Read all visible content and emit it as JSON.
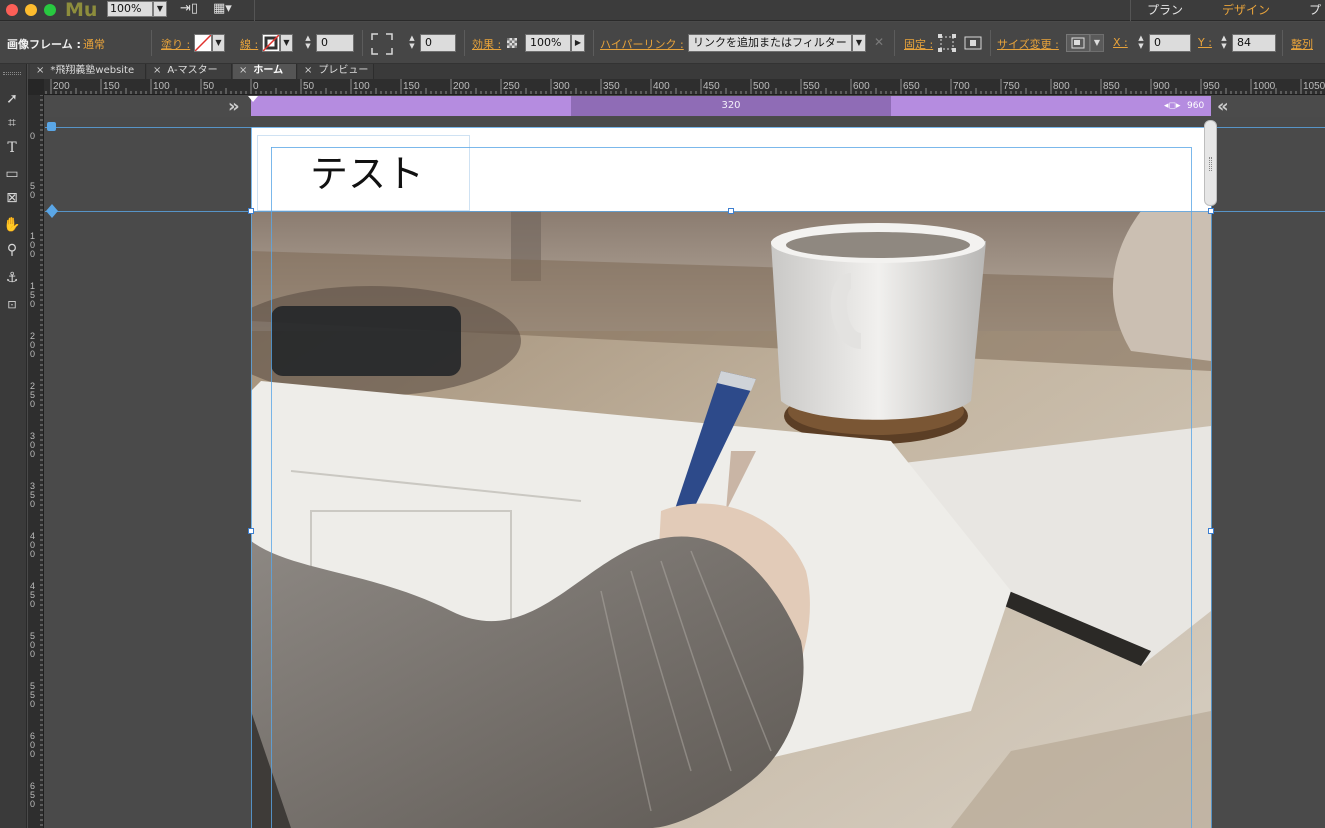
{
  "app": {
    "logo": "Mu",
    "zoom": "100%",
    "mode_tabs": [
      "プラン",
      "デザイン",
      "プ"
    ],
    "active_mode": "デザイン"
  },
  "control_bar": {
    "frame_label": "画像フレーム :",
    "frame_value": "通常",
    "fill_label": "塗り :",
    "stroke_label": "線 :",
    "stroke_width": "0",
    "corner_radius": "0",
    "effects_label": "効果 :",
    "opacity": "100%",
    "hyperlink_label": "ハイパーリンク :",
    "hyperlink_placeholder": "リンクを追加またはフィルター",
    "pin_label": "固定 :",
    "resize_label": "サイズ変更 :",
    "x_label": "X :",
    "x_value": "0",
    "y_label": "Y :",
    "y_value": "84",
    "align_label": "整列"
  },
  "tabs": [
    {
      "label": "*飛翔義塾website",
      "active": false
    },
    {
      "label": "A-マスター",
      "active": false
    },
    {
      "label": "ホーム",
      "active": true
    },
    {
      "label": "プレビュー",
      "active": false
    }
  ],
  "ruler": {
    "h_labels": [
      "200",
      "150",
      "100",
      "50",
      "0",
      "50",
      "100",
      "150",
      "200",
      "250",
      "300",
      "350",
      "400",
      "450",
      "500",
      "550",
      "600",
      "650",
      "700",
      "750",
      "800",
      "850",
      "900",
      "950",
      "1000",
      "1050"
    ],
    "v_labels": [
      "0",
      "50",
      "100",
      "150",
      "200",
      "250",
      "300",
      "350",
      "400",
      "450",
      "500",
      "550",
      "600",
      "650"
    ]
  },
  "breakpoint": {
    "center_label": "320",
    "end_label": "960"
  },
  "page": {
    "heading": "テスト"
  },
  "colors": {
    "accent_orange": "#e8a33b",
    "breakpoint_purple": "#b58ce0",
    "guide_blue": "#5aa6e6"
  }
}
